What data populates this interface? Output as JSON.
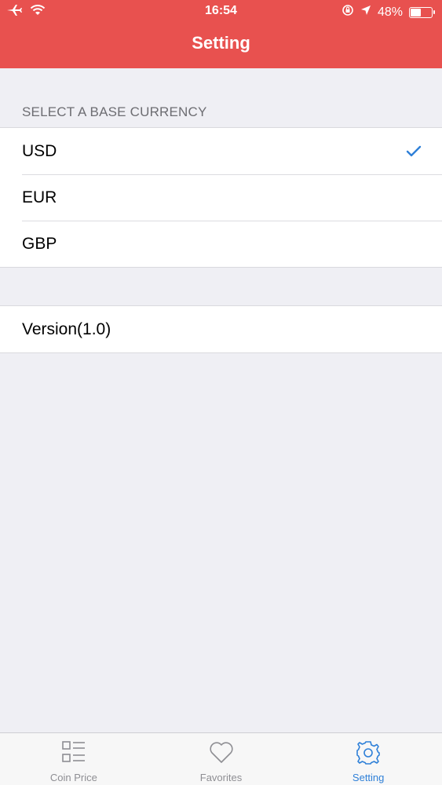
{
  "status_bar": {
    "time": "16:54",
    "battery": "48%",
    "battery_level": 0.48
  },
  "header": {
    "title": "Setting",
    "bg_color": "#e8514f"
  },
  "currency_section": {
    "header": "SELECT A BASE CURRENCY",
    "options": [
      {
        "label": "USD",
        "selected": true
      },
      {
        "label": "EUR",
        "selected": false
      },
      {
        "label": "GBP",
        "selected": false
      }
    ]
  },
  "info_section": {
    "version_label": "Version(1.0)"
  },
  "tabbar": {
    "tabs": [
      {
        "label": "Coin Price",
        "icon": "list-grid-icon",
        "active": false
      },
      {
        "label": "Favorites",
        "icon": "heart-icon",
        "active": false
      },
      {
        "label": "Setting",
        "icon": "gear-icon",
        "active": true
      }
    ],
    "active_color": "#2f80d8"
  }
}
